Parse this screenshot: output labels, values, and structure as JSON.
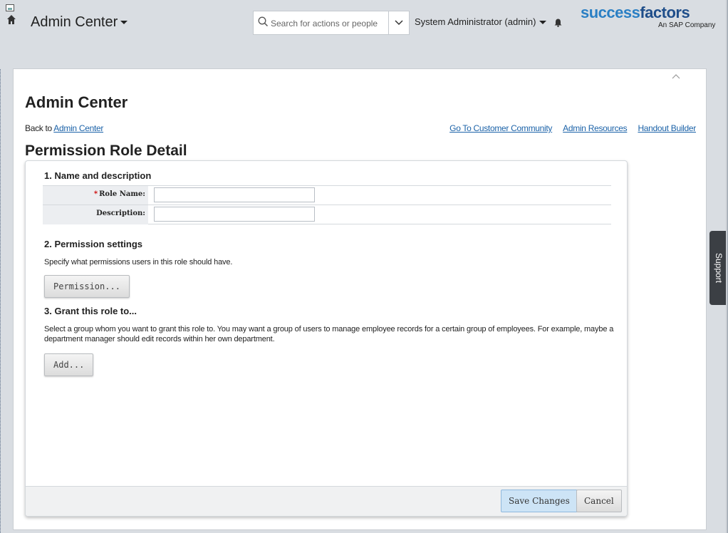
{
  "header": {
    "app_title": "Admin Center",
    "search_placeholder": "Search for actions or people",
    "user_label": "System Administrator (admin)",
    "logo_main_1": "success",
    "logo_main_2": "factors",
    "logo_sub": "An SAP Company",
    "brand_color": "#2a7fc4"
  },
  "page": {
    "title": "Admin Center",
    "back_prefix": "Back to ",
    "back_link": "Admin Center",
    "links": [
      "Go To Customer Community",
      "Admin Resources",
      "Handout Builder"
    ],
    "section_title": "Permission Role Detail"
  },
  "form": {
    "step1_title": "1. Name and description",
    "role_name_required_mark": "*",
    "role_name_label": "Role Name:",
    "role_name_value": "",
    "description_label": "Description:",
    "description_value": "",
    "step2_title": "2. Permission settings",
    "step2_text": "Specify what permissions users in this role should have.",
    "permission_button": "Permission...",
    "step3_title": "3. Grant this role to...",
    "step3_text": "Select a group whom you want to grant this role to. You may want a group of users to manage employee records for a certain group of employees. For example, maybe a department manager should edit records within her own department.",
    "add_button": "Add..."
  },
  "footer": {
    "save_label": "Save Changes",
    "cancel_label": "Cancel"
  },
  "support": {
    "label": "Support"
  },
  "icons": {
    "home": "home-icon",
    "search": "search-icon",
    "dropdown": "chevron-down-icon",
    "bell": "bell-icon",
    "collapse": "chevron-up-icon"
  }
}
